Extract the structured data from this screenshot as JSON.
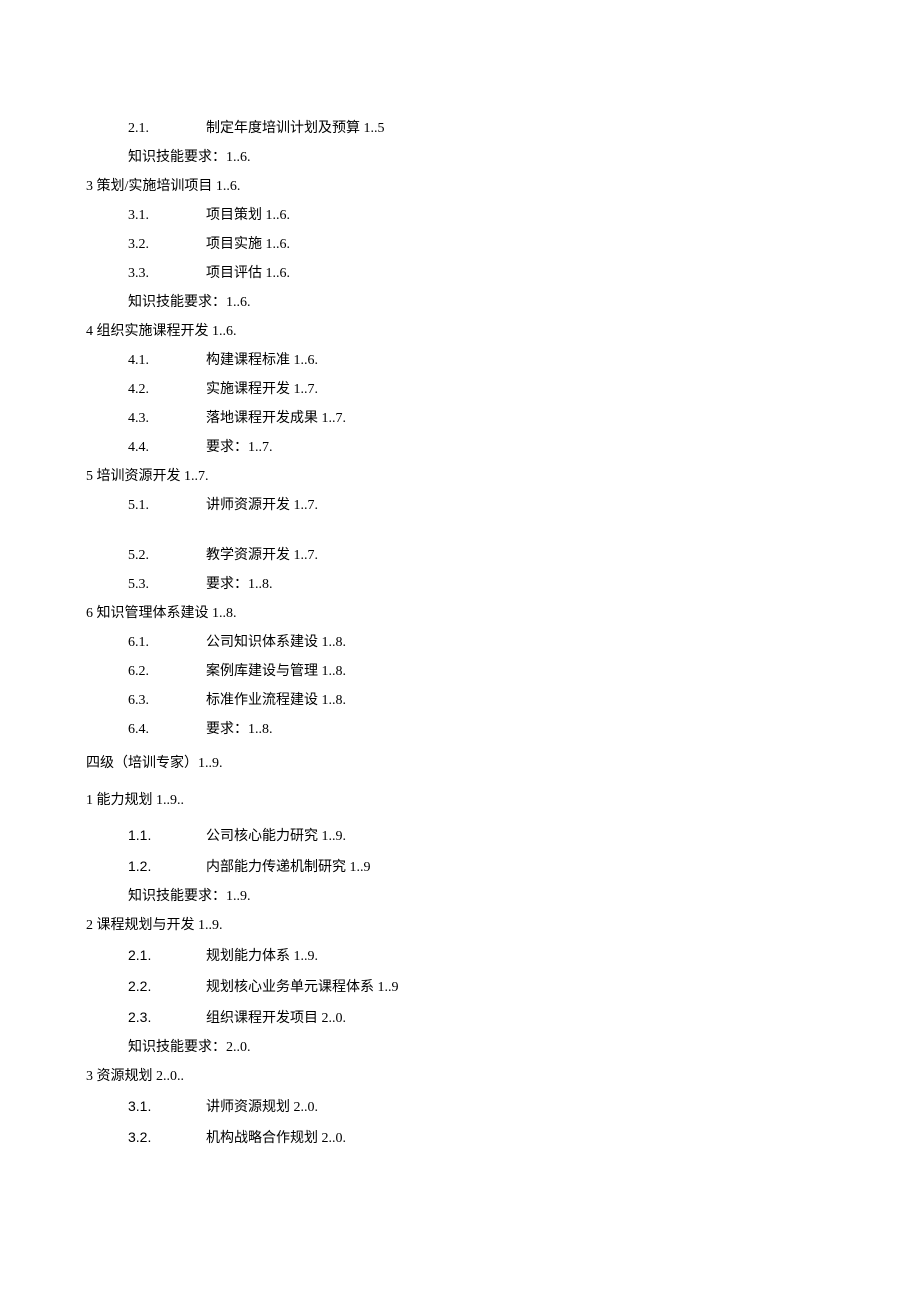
{
  "lines": [
    {
      "indent": 1,
      "num": "2.1.",
      "numStyle": "serif",
      "text": "制定年度培训计划及预算 1..5"
    },
    {
      "indent": 2,
      "num": "",
      "numStyle": "",
      "text": "知识技能要求：1..6."
    },
    {
      "indent": 0,
      "num": "",
      "numStyle": "",
      "text": "3   策划/实施培训项目 1..6."
    },
    {
      "indent": 1,
      "num": "3.1.",
      "numStyle": "serif",
      "text": "项目策划 1..6."
    },
    {
      "indent": 1,
      "num": "3.2.",
      "numStyle": "serif",
      "text": "项目实施 1..6."
    },
    {
      "indent": 1,
      "num": "3.3.",
      "numStyle": "serif",
      "text": "项目评估 1..6."
    },
    {
      "indent": 2,
      "num": "",
      "numStyle": "",
      "text": "知识技能要求：1..6."
    },
    {
      "indent": 0,
      "num": "",
      "numStyle": "",
      "text": "4   组织实施课程开发 1..6."
    },
    {
      "indent": 1,
      "num": "4.1.",
      "numStyle": "serif",
      "text": "构建课程标准 1..6."
    },
    {
      "indent": 1,
      "num": "4.2.",
      "numStyle": "serif",
      "text": "实施课程开发 1..7."
    },
    {
      "indent": 1,
      "num": "4.3.",
      "numStyle": "serif",
      "text": "落地课程开发成果 1..7."
    },
    {
      "indent": 1,
      "num": "4.4.",
      "numStyle": "serif",
      "text": "要求：1..7."
    },
    {
      "indent": 0,
      "num": "",
      "numStyle": "",
      "text": "5   培训资源开发 1..7."
    },
    {
      "indent": 1,
      "num": "5.1.",
      "numStyle": "serif",
      "text": "讲师资源开发 1..7.",
      "extraGap": "big"
    },
    {
      "indent": 1,
      "num": "5.2.",
      "numStyle": "serif",
      "text": "教学资源开发 1..7.",
      "extraGap": "mid"
    },
    {
      "indent": 1,
      "num": "5.3.",
      "numStyle": "serif",
      "text": "要求：1..8."
    },
    {
      "indent": 0,
      "num": "",
      "numStyle": "",
      "text": "6   知识管理体系建设 1..8."
    },
    {
      "indent": 1,
      "num": "6.1.",
      "numStyle": "serif",
      "text": "公司知识体系建设 1..8."
    },
    {
      "indent": 1,
      "num": "6.2.",
      "numStyle": "serif",
      "text": "案例库建设与管理 1..8."
    },
    {
      "indent": 1,
      "num": "6.3.",
      "numStyle": "serif",
      "text": "标准作业流程建设 1..8."
    },
    {
      "indent": 1,
      "num": "6.4.",
      "numStyle": "serif",
      "text": "要求：1..8."
    },
    {
      "indent": 0,
      "num": "",
      "numStyle": "",
      "text": "四级（培训专家）1..9.",
      "extraGap": "section"
    },
    {
      "indent": 0,
      "num": "",
      "numStyle": "",
      "text": "1 能力规划 1..9..",
      "extraGap": "section-after"
    },
    {
      "indent": 1,
      "num": "1.1.",
      "numStyle": "sans",
      "text": "公司核心能力研究 1..9."
    },
    {
      "indent": 1,
      "num": "1.2.",
      "numStyle": "sans",
      "text": "内部能力传递机制研究 1..9"
    },
    {
      "indent": 2,
      "num": "",
      "numStyle": "",
      "text": "知识技能要求：1..9."
    },
    {
      "indent": 0,
      "num": "",
      "numStyle": "",
      "text": "2   课程规划与开发 1..9."
    },
    {
      "indent": 1,
      "num": "2.1.",
      "numStyle": "sans",
      "text": "规划能力体系 1..9."
    },
    {
      "indent": 1,
      "num": "2.2.",
      "numStyle": "sans",
      "text": "规划核心业务单元课程体系 1..9"
    },
    {
      "indent": 1,
      "num": "2.3.",
      "numStyle": "sans",
      "text": "组织课程开发项目 2..0."
    },
    {
      "indent": 2,
      "num": "",
      "numStyle": "",
      "text": "知识技能要求：2..0."
    },
    {
      "indent": 0,
      "num": "",
      "numStyle": "",
      "text": "3    资源规划 2..0.."
    },
    {
      "indent": 1,
      "num": "3.1.",
      "numStyle": "sans",
      "text": "讲师资源规划 2..0."
    },
    {
      "indent": 1,
      "num": "3.2.",
      "numStyle": "sans",
      "text": "机构战略合作规划 2..0."
    }
  ]
}
